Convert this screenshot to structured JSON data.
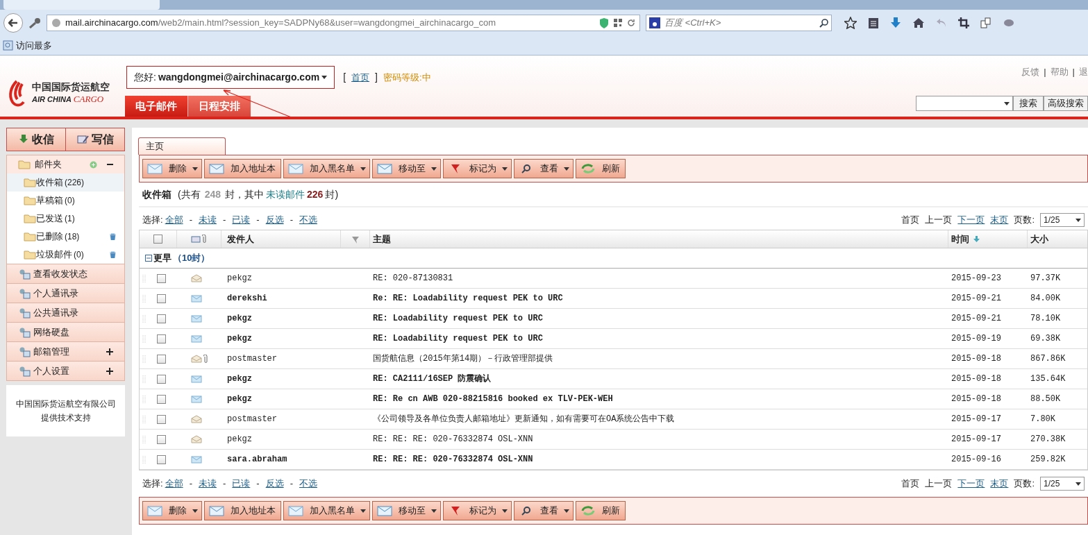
{
  "browser": {
    "url_host": "mail.airchinacargo.com",
    "url_path": "/web2/main.html?session_key=SADPNy68&user=wangdongmei_airchinacargo_com",
    "search_placeholder": "百度 <Ctrl+K>",
    "bookmark": "访问最多"
  },
  "header": {
    "logo_cn": "中国国际货运航空",
    "logo_en_1": "AIR CHINA",
    "logo_en_2": "CARGO",
    "greeting": "您好:",
    "user": "wangdongmei@airchinacargo.com",
    "home_open": "[",
    "home": "首页",
    "home_close": "]",
    "password_level": "密码等级:中",
    "tabs": [
      {
        "label": "电子邮件",
        "selected": true
      },
      {
        "label": "日程安排",
        "selected": false
      }
    ],
    "top_links": [
      "反馈",
      "帮助",
      "退"
    ],
    "top_link_separator": "|",
    "search_button": "搜索",
    "advanced_search": "高级搜索"
  },
  "sidebar": {
    "receive": "收信",
    "compose": "写信",
    "folders_title": "邮件夹",
    "folders": [
      {
        "name": "收件箱",
        "count": "(226)",
        "selected": true,
        "trash": false
      },
      {
        "name": "草稿箱",
        "count": "(0)",
        "selected": false,
        "trash": false
      },
      {
        "name": "已发送",
        "count": "(1)",
        "selected": false,
        "trash": false
      },
      {
        "name": "已删除",
        "count": "(18)",
        "selected": false,
        "trash": true
      },
      {
        "name": "垃圾邮件",
        "count": "(0)",
        "selected": false,
        "trash": true
      }
    ],
    "sections": [
      {
        "label": "查看收发状态",
        "expandable": false
      },
      {
        "label": "个人通讯录",
        "expandable": false
      },
      {
        "label": "公共通讯录",
        "expandable": false
      },
      {
        "label": "网络硬盘",
        "expandable": false
      },
      {
        "label": "邮箱管理",
        "expandable": true
      },
      {
        "label": "个人设置",
        "expandable": true
      }
    ],
    "footer": [
      "中国国际货运航空有限公司",
      "提供技术支持"
    ]
  },
  "main": {
    "tab": "主页",
    "toolbar_top": [
      {
        "label": "删除",
        "dropdown": true
      },
      {
        "label": "加入地址本",
        "dropdown": false
      },
      {
        "label": "加入黑名单",
        "dropdown": true
      },
      {
        "label": "移动至",
        "dropdown": true
      },
      {
        "label": "标记为",
        "dropdown": true
      },
      {
        "label": "查看",
        "dropdown": true
      },
      {
        "label": "刷新",
        "dropdown": false
      }
    ],
    "summary": {
      "folder": "收件箱",
      "p1": "(共有",
      "total": "248",
      "p2": "封，其中",
      "unread_label": "未读邮件",
      "unread": "226",
      "p3": "封)"
    },
    "select_top": {
      "label": "选择:",
      "separator": "-",
      "links": [
        "全部",
        "未读",
        "已读",
        "反选",
        "不选"
      ]
    },
    "pager": {
      "first": "首页",
      "prev": "上一页",
      "next": "下一页",
      "last": "末页",
      "pages_label": "页数:",
      "page": "1/25"
    },
    "columns": {
      "all_checked": false,
      "sender": "发件人",
      "subject": "主题",
      "time": "时间",
      "size": "大小"
    },
    "group": {
      "label": "更早",
      "count": "（10封）"
    },
    "rows": [
      {
        "sender": "pekgz",
        "subject": "RE: 020-87130831",
        "time": "2015-09-23",
        "size": "97.37K",
        "checked": false,
        "unread": false,
        "attachment": false
      },
      {
        "sender": "derekshi",
        "subject": "Re: RE: Loadability request PEK to URC",
        "time": "2015-09-21",
        "size": "84.00K",
        "checked": false,
        "unread": true,
        "attachment": false
      },
      {
        "sender": "pekgz",
        "subject": "RE: Loadability request PEK to URC",
        "time": "2015-09-21",
        "size": "78.10K",
        "checked": false,
        "unread": true,
        "attachment": false
      },
      {
        "sender": "pekgz",
        "subject": "RE: Loadability request PEK to URC",
        "time": "2015-09-19",
        "size": "69.38K",
        "checked": false,
        "unread": true,
        "attachment": false
      },
      {
        "sender": "postmaster",
        "subject": "国货航信息（2015年第14期）－行政管理部提供",
        "time": "2015-09-18",
        "size": "867.86K",
        "checked": false,
        "unread": false,
        "attachment": true
      },
      {
        "sender": "pekgz",
        "subject": "RE: CA2111/16SEP 防震确认",
        "time": "2015-09-18",
        "size": "135.64K",
        "checked": false,
        "unread": true,
        "attachment": false
      },
      {
        "sender": "pekgz",
        "subject": "RE: Re cn AWB 020-88215816 booked ex TLV-PEK-WEH",
        "time": "2015-09-18",
        "size": "88.50K",
        "checked": false,
        "unread": true,
        "attachment": false
      },
      {
        "sender": "postmaster",
        "subject": "《公司领导及各单位负责人邮箱地址》更新通知，如有需要可在OA系统公告中下载",
        "time": "2015-09-17",
        "size": "7.80K",
        "checked": false,
        "unread": false,
        "attachment": false
      },
      {
        "sender": "pekgz",
        "subject": "RE: RE: RE: 020-76332874 OSL-XNN",
        "time": "2015-09-17",
        "size": "270.38K",
        "checked": false,
        "unread": false,
        "attachment": false
      },
      {
        "sender": "sara.abraham",
        "subject": "RE: RE: RE: 020-76332874 OSL-XNN",
        "time": "2015-09-16",
        "size": "259.82K",
        "checked": false,
        "unread": true,
        "attachment": false
      }
    ],
    "select_bottom": {
      "label": "选择:",
      "separator": "-",
      "links": [
        "全部",
        "未读",
        "已读",
        "反选",
        "不选"
      ]
    },
    "pager_bottom": {
      "first": "首页",
      "prev": "上一页",
      "next": "下一页",
      "last": "末页",
      "pages_label": "页数:",
      "page": "1/25"
    },
    "toolbar_bottom": [
      {
        "label": "删除",
        "dropdown": true
      },
      {
        "label": "加入地址本",
        "dropdown": false
      },
      {
        "label": "加入黑名单",
        "dropdown": true
      },
      {
        "label": "移动至",
        "dropdown": true
      },
      {
        "label": "标记为",
        "dropdown": true
      },
      {
        "label": "查看",
        "dropdown": true
      },
      {
        "label": "刷新",
        "dropdown": false
      }
    ]
  }
}
